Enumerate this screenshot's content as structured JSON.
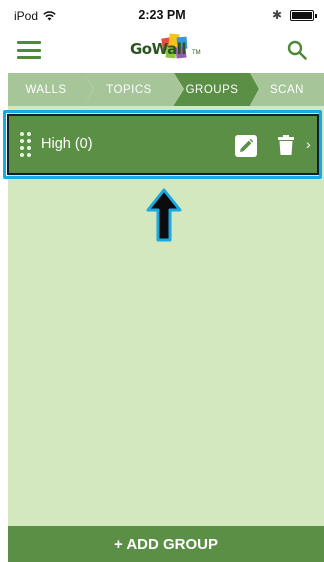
{
  "status_bar": {
    "carrier": "iPod",
    "time": "2:23 PM",
    "icons": [
      "wifi-icon",
      "bluetooth-icon",
      "battery-icon"
    ]
  },
  "header": {
    "menu_icon": "hamburger-icon",
    "logo_text": "GoWall",
    "logo_tm": "TM",
    "search_icon": "search-icon",
    "accent_color": "#4e8a37"
  },
  "tabs": [
    {
      "label": "WALLS",
      "active": false
    },
    {
      "label": "TOPICS",
      "active": false
    },
    {
      "label": "GROUPS",
      "active": true
    },
    {
      "label": "SCAN",
      "active": false
    }
  ],
  "groups": [
    {
      "label": "High (0)",
      "icons": [
        "drag-handle-icon",
        "edit-icon",
        "trash-icon",
        "chevron-right-icon"
      ]
    }
  ],
  "footer": {
    "add_button_label": "+ ADD GROUP"
  },
  "colors": {
    "primary_green": "#5b8f45",
    "tab_inactive": "#a6c69a",
    "content_bg": "#d3e8bf",
    "highlight_border": "#1aa9e0"
  }
}
